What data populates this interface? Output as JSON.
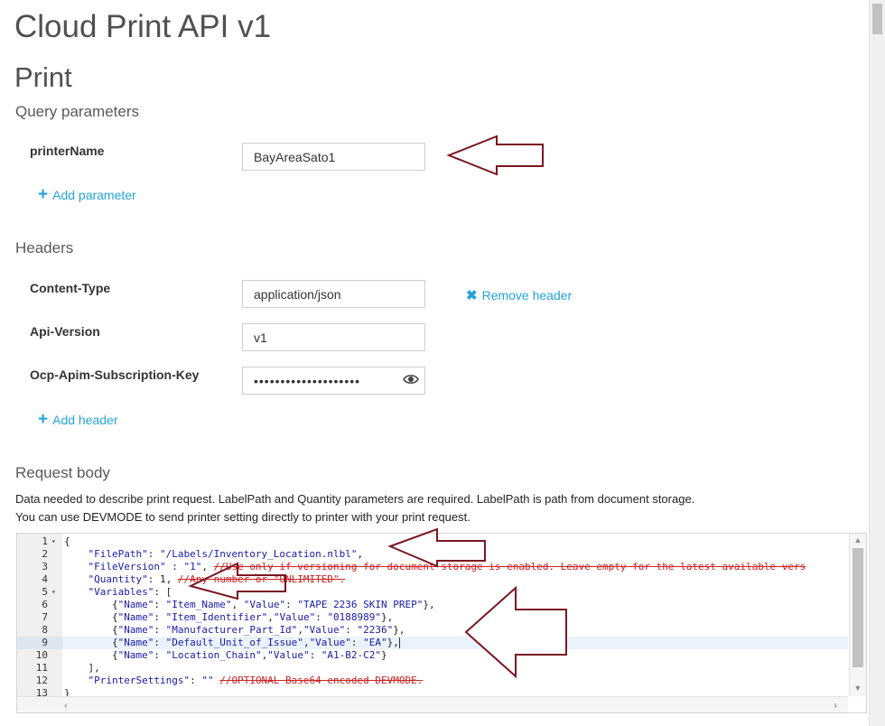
{
  "page": {
    "title": "Cloud Print API v1",
    "operation": "Print"
  },
  "query": {
    "heading": "Query parameters",
    "params": [
      {
        "name": "printerName",
        "value": "BayAreaSato1"
      }
    ],
    "add_label": "Add parameter"
  },
  "headers": {
    "heading": "Headers",
    "items": [
      {
        "name": "Content-Type",
        "value": "application/json"
      },
      {
        "name": "Api-Version",
        "value": "v1"
      },
      {
        "name": "Ocp-Apim-Subscription-Key",
        "value": "••••••••••••••••••••"
      }
    ],
    "remove_label": "Remove header",
    "add_label": "Add header"
  },
  "body": {
    "heading": "Request body",
    "description_1": "Data needed to describe print request. LabelPath and Quantity parameters are required. LabelPath is path from document storage.",
    "description_2": "You can use DEVMODE to send printer setting directly to printer with your print request.",
    "code_lines": [
      {
        "n": "1",
        "fold": "▾",
        "parts": [
          {
            "t": "{",
            "c": ""
          }
        ]
      },
      {
        "n": "2",
        "parts": [
          {
            "t": "    \"FilePath\": ",
            "c": "str"
          },
          {
            "t": "\"/Labels/Inventory_Location.nlbl\"",
            "c": "str"
          },
          {
            "t": ",",
            "c": ""
          }
        ]
      },
      {
        "n": "3",
        "parts": [
          {
            "t": "    \"FileVersion\" : \"1\"",
            "c": "str"
          },
          {
            "t": ", ",
            "c": ""
          },
          {
            "t": "//Use only if versioning for document storage is enabled. Leave empty for the latest available vers",
            "c": "strk"
          }
        ]
      },
      {
        "n": "4",
        "parts": [
          {
            "t": "    \"Quantity\"",
            "c": "str"
          },
          {
            "t": ": 1, ",
            "c": ""
          },
          {
            "t": "//Any number or \"UNLIMITED\".",
            "c": "strk"
          }
        ]
      },
      {
        "n": "5",
        "fold": "▾",
        "parts": [
          {
            "t": "    \"Variables\"",
            "c": "str"
          },
          {
            "t": ": [",
            "c": ""
          }
        ]
      },
      {
        "n": "6",
        "parts": [
          {
            "t": "        {",
            "c": ""
          },
          {
            "t": "\"Name\"",
            "c": "str"
          },
          {
            "t": ": ",
            "c": ""
          },
          {
            "t": "\"Item_Name\"",
            "c": "str"
          },
          {
            "t": ", ",
            "c": ""
          },
          {
            "t": "\"Value\"",
            "c": "str"
          },
          {
            "t": ": ",
            "c": ""
          },
          {
            "t": "\"TAPE 2236 SKIN PREP\"",
            "c": "str"
          },
          {
            "t": "},",
            "c": ""
          }
        ]
      },
      {
        "n": "7",
        "parts": [
          {
            "t": "        {",
            "c": ""
          },
          {
            "t": "\"Name\"",
            "c": "str"
          },
          {
            "t": ": ",
            "c": ""
          },
          {
            "t": "\"Item_Identifier\"",
            "c": "str"
          },
          {
            "t": ",",
            "c": ""
          },
          {
            "t": "\"Value\"",
            "c": "str"
          },
          {
            "t": ": ",
            "c": ""
          },
          {
            "t": "\"0188989\"",
            "c": "str"
          },
          {
            "t": "},",
            "c": ""
          }
        ]
      },
      {
        "n": "8",
        "parts": [
          {
            "t": "        {",
            "c": ""
          },
          {
            "t": "\"Name\"",
            "c": "str"
          },
          {
            "t": ": ",
            "c": ""
          },
          {
            "t": "\"Manufacturer_Part_Id\"",
            "c": "str"
          },
          {
            "t": ",",
            "c": ""
          },
          {
            "t": "\"Value\"",
            "c": "str"
          },
          {
            "t": ": ",
            "c": ""
          },
          {
            "t": "\"2236\"",
            "c": "str"
          },
          {
            "t": "},",
            "c": ""
          }
        ]
      },
      {
        "n": "9",
        "active": true,
        "parts": [
          {
            "t": "        {",
            "c": ""
          },
          {
            "t": "\"Name\"",
            "c": "str"
          },
          {
            "t": ": ",
            "c": ""
          },
          {
            "t": "\"Default_Unit_of_Issue\"",
            "c": "str"
          },
          {
            "t": ",",
            "c": ""
          },
          {
            "t": "\"Value\"",
            "c": "str"
          },
          {
            "t": ": ",
            "c": ""
          },
          {
            "t": "\"EA\"",
            "c": "str"
          },
          {
            "t": "},",
            "c": ""
          }
        ]
      },
      {
        "n": "10",
        "parts": [
          {
            "t": "        {",
            "c": ""
          },
          {
            "t": "\"Name\"",
            "c": "str"
          },
          {
            "t": ": ",
            "c": ""
          },
          {
            "t": "\"Location_Chain\"",
            "c": "str"
          },
          {
            "t": ",",
            "c": ""
          },
          {
            "t": "\"Value\"",
            "c": "str"
          },
          {
            "t": ": ",
            "c": ""
          },
          {
            "t": "\"A1-B2-C2\"",
            "c": "str"
          },
          {
            "t": "}",
            "c": ""
          }
        ]
      },
      {
        "n": "11",
        "parts": [
          {
            "t": "    ],",
            "c": ""
          }
        ]
      },
      {
        "n": "12",
        "parts": [
          {
            "t": "    \"PrinterSettings\"",
            "c": "str"
          },
          {
            "t": ": ",
            "c": ""
          },
          {
            "t": "\"\"",
            "c": "str"
          },
          {
            "t": " ",
            "c": ""
          },
          {
            "t": "//OPTIONAL Base64 encoded DEVMODE.",
            "c": "strk"
          }
        ]
      },
      {
        "n": "13",
        "parts": [
          {
            "t": "}",
            "c": ""
          }
        ]
      }
    ]
  },
  "icons": {
    "plus": "plus-icon",
    "remove": "close-icon",
    "eye": "eye-icon",
    "annotation": "arrow-annotation"
  },
  "colors": {
    "link": "#23a4d8",
    "annotation": "#7a1722",
    "comment": "#cc2222",
    "string": "#1a1aa6"
  }
}
